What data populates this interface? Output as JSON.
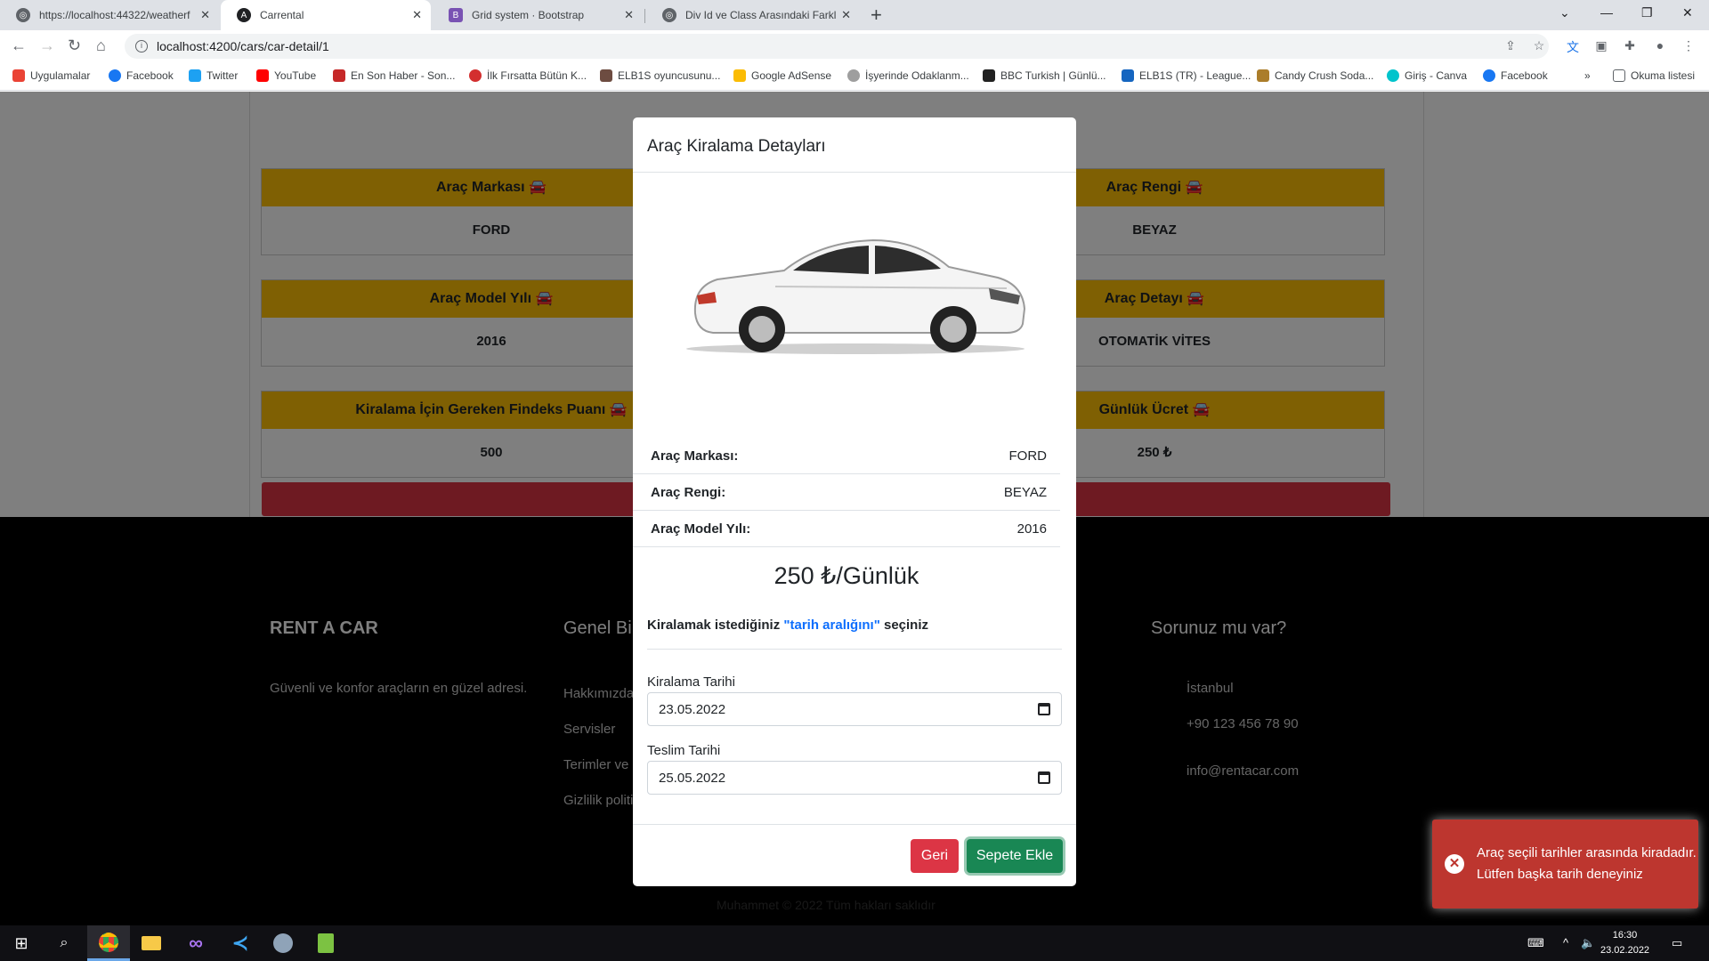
{
  "browser": {
    "tabs": [
      {
        "label": "https://localhost:44322/weatherf",
        "active": false,
        "icon": "globe-icon",
        "color": "#5f6368"
      },
      {
        "label": "Carrental",
        "active": true,
        "icon": "angular-icon",
        "color": "#202124"
      },
      {
        "label": "Grid system · Bootstrap",
        "active": false,
        "icon": "bootstrap-icon",
        "color": "#7952b3"
      },
      {
        "label": "Div Id ve Class Arasındaki Farklar",
        "active": false,
        "icon": "globe-icon",
        "color": "#5f6368"
      }
    ],
    "url": "localhost:4200/cars/car-detail/1",
    "bookmarks": [
      {
        "label": "Uygulamalar",
        "color": "#ea4335"
      },
      {
        "label": "Facebook",
        "color": "#1877f2"
      },
      {
        "label": "Twitter",
        "color": "#1da1f2"
      },
      {
        "label": "YouTube",
        "color": "#ff0000"
      },
      {
        "label": "En Son Haber - Son...",
        "color": "#c62828"
      },
      {
        "label": "İlk Fırsatta Bütün K...",
        "color": "#d32f2f"
      },
      {
        "label": "ELB1S oyuncusunu...",
        "color": "#6d4c41"
      },
      {
        "label": "Google AdSense",
        "color": "#fbbc04"
      },
      {
        "label": "İşyerinde Odaklanm...",
        "color": "#9e9e9e"
      },
      {
        "label": "BBC Turkish | Günlü...",
        "color": "#212121"
      },
      {
        "label": "ELB1S (TR) - League...",
        "color": "#1565c0"
      },
      {
        "label": "Candy Crush Soda...",
        "color": "#ab7d2a"
      },
      {
        "label": "Giriş - Canva",
        "color": "#00c4cc"
      },
      {
        "label": "Facebook",
        "color": "#1877f2"
      }
    ],
    "reading_list": "Okuma listesi"
  },
  "page": {
    "cards": [
      {
        "header": "Araç Markası",
        "value": "FORD"
      },
      {
        "header": "Araç Rengi",
        "value": "BEYAZ"
      },
      {
        "header": "Araç Model Yılı",
        "value": "2016"
      },
      {
        "header": "Araç Detayı",
        "value": "OTOMATİK VİTES"
      },
      {
        "header": "Kiralama İçin Gereken Findeks Puanı",
        "value": "500"
      },
      {
        "header": "Günlük Ücret",
        "value": "250 ₺"
      }
    ],
    "back_label": "Geri"
  },
  "footer": {
    "brand": "RENT A CAR",
    "tagline": "Güvenli ve konfor araçların en güzel adresi.",
    "info_title": "Genel Bilgiler",
    "links": [
      "Hakkımızda",
      "Servisler",
      "Terimler ve Koşullar",
      "Gizlilik politikası"
    ],
    "contact_title": "Sorunuz mu var?",
    "city": "İstanbul",
    "phone": "+90 123 456 78 90",
    "email": "info@rentacar.com",
    "copyright": "Muhammet © 2022 Tüm hakları saklıdır"
  },
  "modal": {
    "title": "Araç Kiralama Detayları",
    "details": [
      {
        "label": "Araç Markası:",
        "value": "FORD"
      },
      {
        "label": "Araç Rengi:",
        "value": "BEYAZ"
      },
      {
        "label": "Araç Model Yılı:",
        "value": "2016"
      }
    ],
    "price": "250 ₺/Günlük",
    "prompt_pre": "Kiralamak istediğiniz ",
    "prompt_highlight": "\"tarih aralığını\"",
    "prompt_post": " seçiniz",
    "rent_date_label": "Kiralama Tarihi",
    "rent_date_value": "23.05.2022",
    "return_date_label": "Teslim Tarihi",
    "return_date_value": "25.05.2022",
    "back_button": "Geri",
    "add_to_cart_button": "Sepete Ekle"
  },
  "toast": {
    "message": "Araç seçili tarihler arasında kiradadır. Lütfen başka tarih deneyiniz"
  },
  "taskbar": {
    "time": "16:30",
    "date": "23.02.2022"
  }
}
